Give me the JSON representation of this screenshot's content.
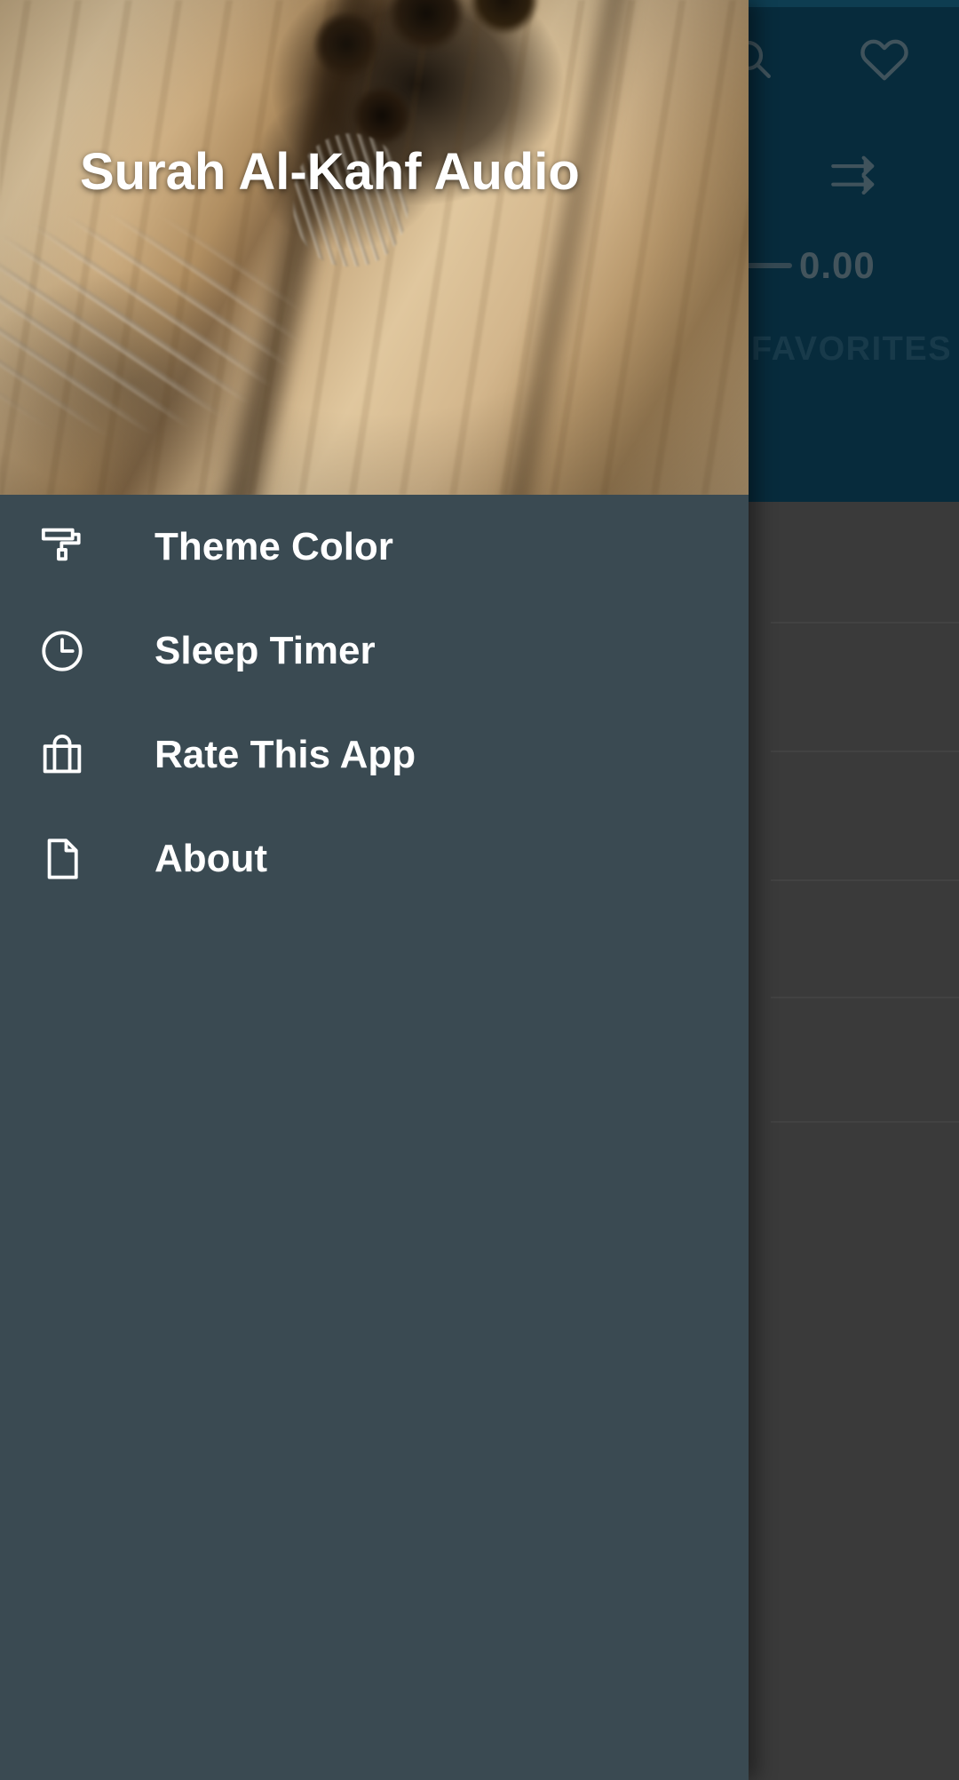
{
  "app": {
    "title": "Surah Al-Kahf Audio",
    "accent_blue": "#0d4f6e",
    "drawer_bg": "#3a4a52",
    "scrim": "#666666"
  },
  "toolbar": {
    "search_icon": "search-icon",
    "favorite_icon": "heart-icon",
    "sort_icon": "double-arrow-right-icon"
  },
  "player": {
    "time_value": "0.00",
    "seek_track": "seekbar"
  },
  "tabs": [
    {
      "label": "FAVORITES",
      "visible_text": "VORITES",
      "selected": false
    }
  ],
  "fab": {
    "icon": "refresh-sync-icon",
    "color": "#0d5375"
  },
  "drawer": {
    "header_title": "Surah Al-Kahf Audio",
    "header_image": "quran-book-with-tasbih-beads-photo",
    "items": [
      {
        "label": "Theme Color",
        "icon": "paint-roller-icon"
      },
      {
        "label": "Sleep Timer",
        "icon": "clock-icon"
      },
      {
        "label": "Rate This App",
        "icon": "shopping-bag-icon"
      },
      {
        "label": "About",
        "icon": "document-icon"
      }
    ]
  },
  "background_list": {
    "divider_tops": [
      700,
      845,
      990,
      1122,
      1262
    ]
  }
}
